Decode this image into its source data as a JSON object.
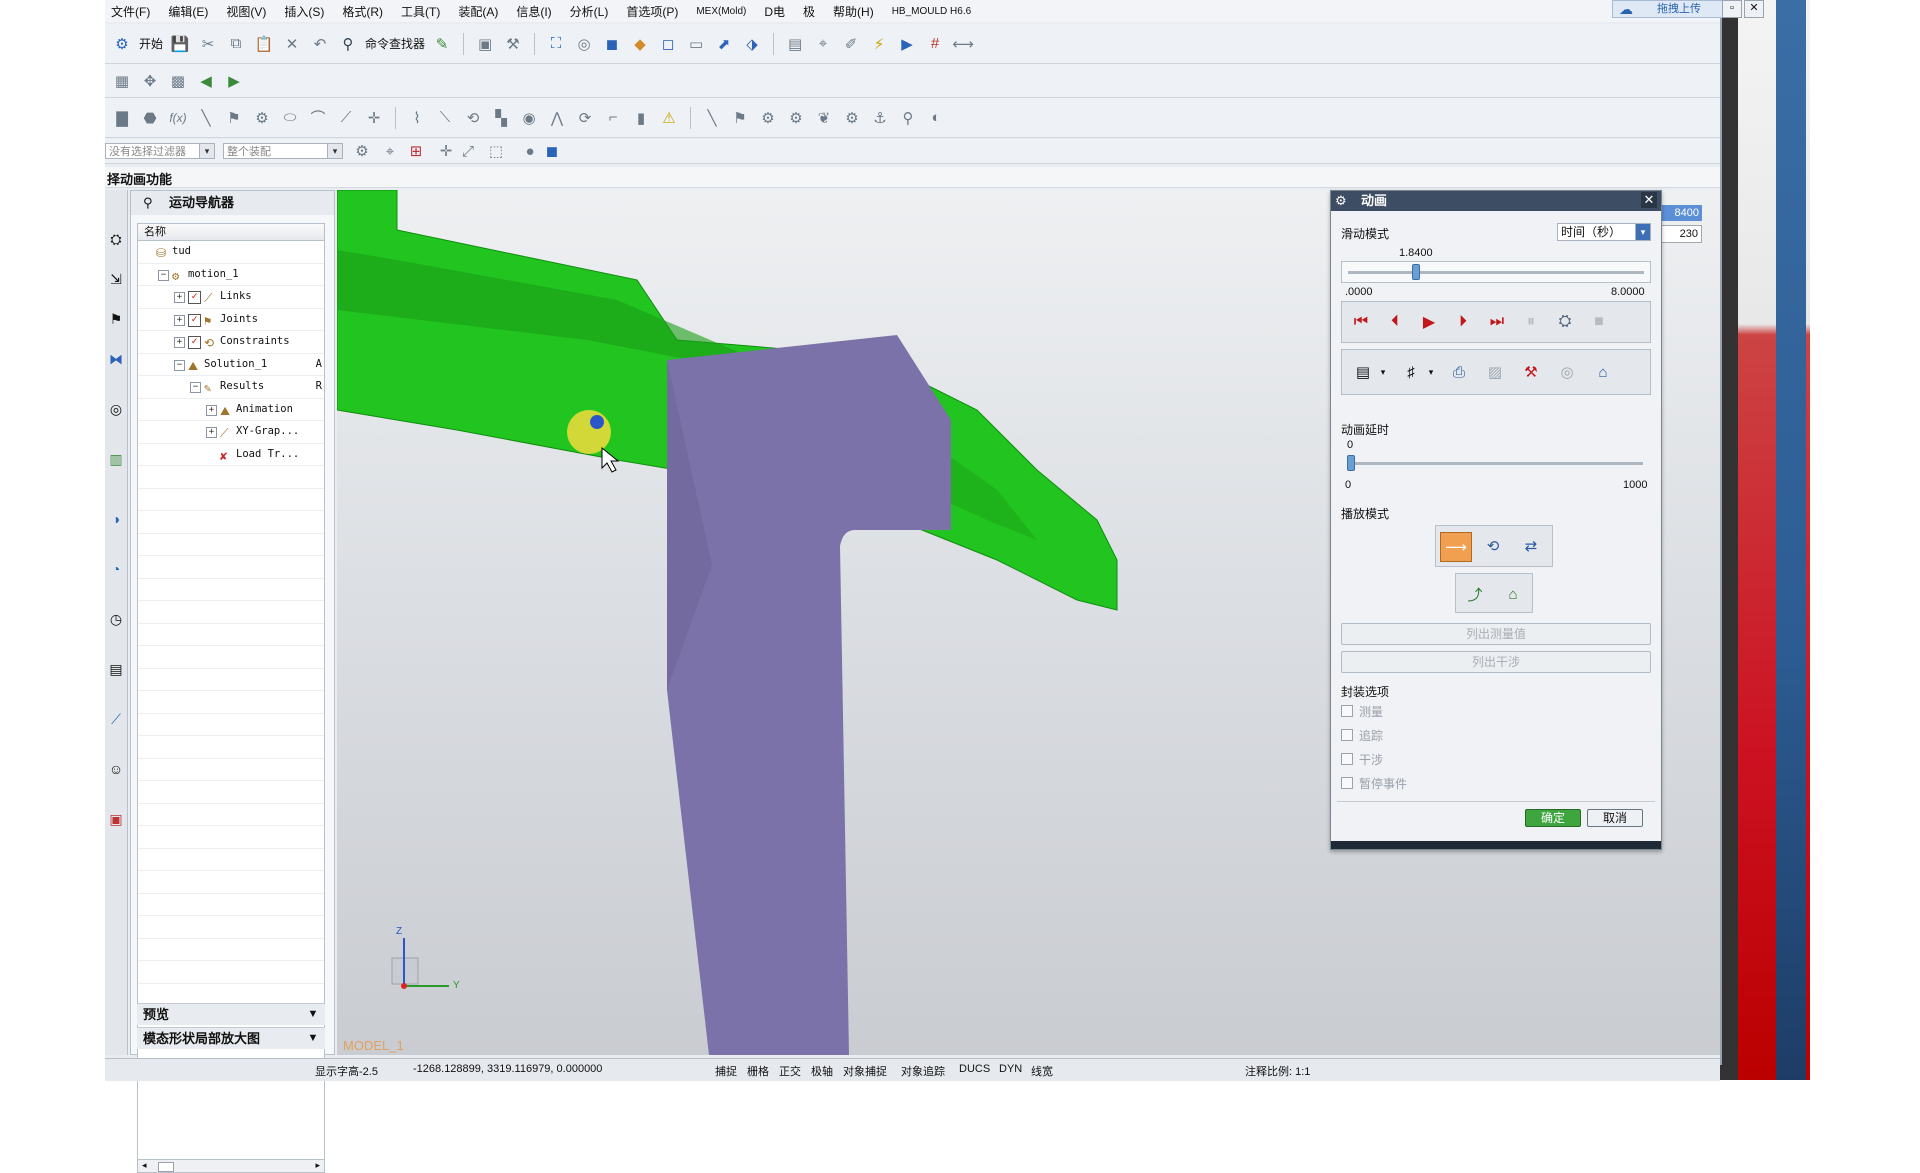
{
  "menu": [
    "文件(F)",
    "编辑(E)",
    "视图(V)",
    "插入(S)",
    "格式(R)",
    "工具(T)",
    "装配(A)",
    "信息(I)",
    "分析(L)",
    "首选项(P)",
    "MEX(Mold)",
    "D电",
    "极",
    "帮助(H)",
    "HB_MOULD H6.6"
  ],
  "toolbar": {
    "start_label": "开始",
    "command_finder": "命令查找器"
  },
  "filterbar": {
    "filter_placeholder": "没有选择过滤器",
    "scope": "整个装配"
  },
  "cue_line": "择动画功能",
  "top_right": {
    "cloud_label": "拖拽上传",
    "window_min": "▫",
    "window_close": "✕"
  },
  "side_values": {
    "top": "8400",
    "bottom": "230"
  },
  "navigator": {
    "title": "运动导航器",
    "column_header": "名称",
    "tree": [
      {
        "label": "tud",
        "indent": 0,
        "icon": "assembly-icon"
      },
      {
        "label": "motion_1",
        "indent": 1,
        "icon": "motion-icon",
        "expander": "−"
      },
      {
        "label": "Links",
        "indent": 2,
        "icon": "link-icon",
        "expander": "+",
        "checked": true
      },
      {
        "label": "Joints",
        "indent": 2,
        "icon": "joint-icon",
        "expander": "+",
        "checked": true
      },
      {
        "label": "Constraints",
        "indent": 2,
        "icon": "constraint-icon",
        "expander": "+",
        "checked": true
      },
      {
        "label": "Solution_1",
        "indent": 2,
        "icon": "solution-icon",
        "expander": "−",
        "tag": "A"
      },
      {
        "label": "Results",
        "indent": 3,
        "icon": "results-icon",
        "expander": "−",
        "tag": "R"
      },
      {
        "label": "Animation",
        "indent": 4,
        "icon": "animation-icon",
        "expander": "+"
      },
      {
        "label": "XY-Grap...",
        "indent": 4,
        "icon": "xy-graph-icon",
        "expander": "+"
      },
      {
        "label": "Load Tr...",
        "indent": 4,
        "icon": "load-transfer-icon"
      }
    ],
    "panels": [
      "预览",
      "模态形状局部放大图"
    ]
  },
  "graphics": {
    "model_label": "MODEL_1",
    "triad": {
      "z": "Z",
      "y": "Y"
    }
  },
  "dialog": {
    "title": "动画",
    "slider_mode_label": "滑动模式",
    "slider_mode_value": "时间（秒）",
    "time_value": "1.8400",
    "time_min": ".0000",
    "time_max": "8.0000",
    "time_fraction": 0.23,
    "delay_label": "动画延时",
    "delay_value": "0",
    "delay_min": "0",
    "delay_max": "1000",
    "delay_fraction": 0.0,
    "playback_label": "播放模式",
    "btn_list_measure": "列出测量值",
    "btn_list_interference": "列出干涉",
    "package_label": "封装选项",
    "options": [
      "测量",
      "追踪",
      "干涉",
      "暂停事件"
    ],
    "ok": "确定",
    "cancel": "取消"
  },
  "status": {
    "left": "显示字高-2.5",
    "coords": "-1268.128899, 3319.116979, 0.000000",
    "items": [
      "捕捉",
      "栅格",
      "正交",
      "极轴",
      "对象捕捉",
      "对象追踪",
      "DUCS",
      "DYN",
      "线宽"
    ],
    "scale": "注释比例: 1:1"
  },
  "colors": {
    "green_part": "#22c41f",
    "purple_part": "#7a72a8",
    "dialog_title": "#3d4d63",
    "accent_red": "#c0181b"
  }
}
